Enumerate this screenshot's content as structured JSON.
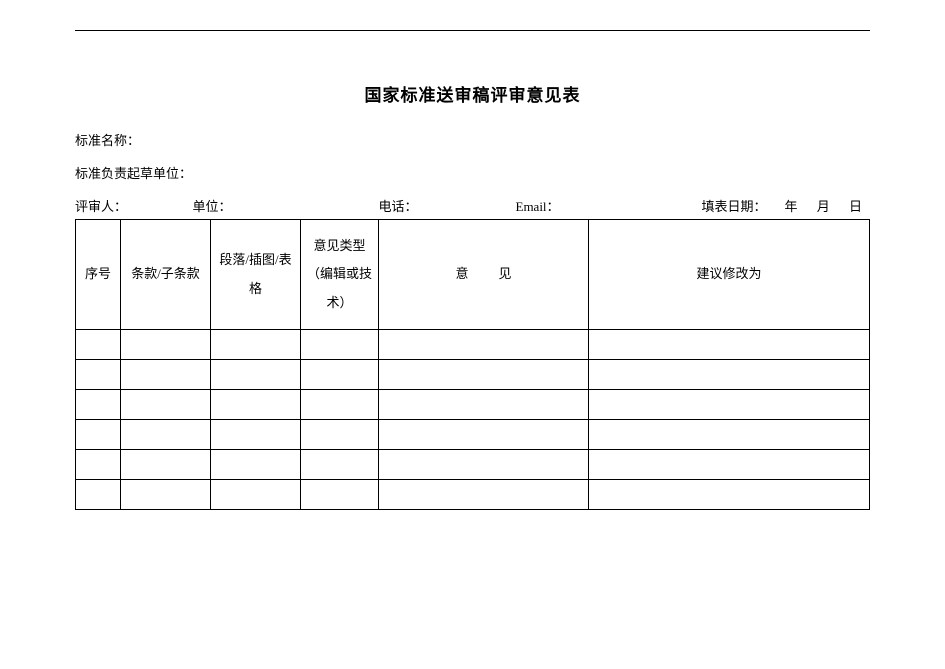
{
  "title": "国家标准送审稿评审意见表",
  "meta": {
    "standard_name_label": "标准名称：",
    "standard_name_value": "",
    "draft_unit_label": "标准负责起草单位：",
    "draft_unit_value": ""
  },
  "reviewer": {
    "reviewer_label": "评审人：",
    "reviewer_value": "",
    "unit_label": "单位：",
    "unit_value": "",
    "phone_label": "电话：",
    "phone_value": "",
    "email_label": "Email：",
    "email_value": "",
    "date_label": "填表日期：",
    "date_value_template": "年 月 日"
  },
  "columns": {
    "index": "序号",
    "clause": "条款/子条款",
    "paragraph": "段落/插图/表格",
    "type": "意见类型（编辑或技术）",
    "opinion": "意见",
    "suggestion": "建议修改为"
  },
  "rows": [
    {
      "index": "",
      "clause": "",
      "paragraph": "",
      "type": "",
      "opinion": "",
      "suggestion": ""
    },
    {
      "index": "",
      "clause": "",
      "paragraph": "",
      "type": "",
      "opinion": "",
      "suggestion": ""
    },
    {
      "index": "",
      "clause": "",
      "paragraph": "",
      "type": "",
      "opinion": "",
      "suggestion": ""
    },
    {
      "index": "",
      "clause": "",
      "paragraph": "",
      "type": "",
      "opinion": "",
      "suggestion": ""
    },
    {
      "index": "",
      "clause": "",
      "paragraph": "",
      "type": "",
      "opinion": "",
      "suggestion": ""
    },
    {
      "index": "",
      "clause": "",
      "paragraph": "",
      "type": "",
      "opinion": "",
      "suggestion": ""
    }
  ]
}
